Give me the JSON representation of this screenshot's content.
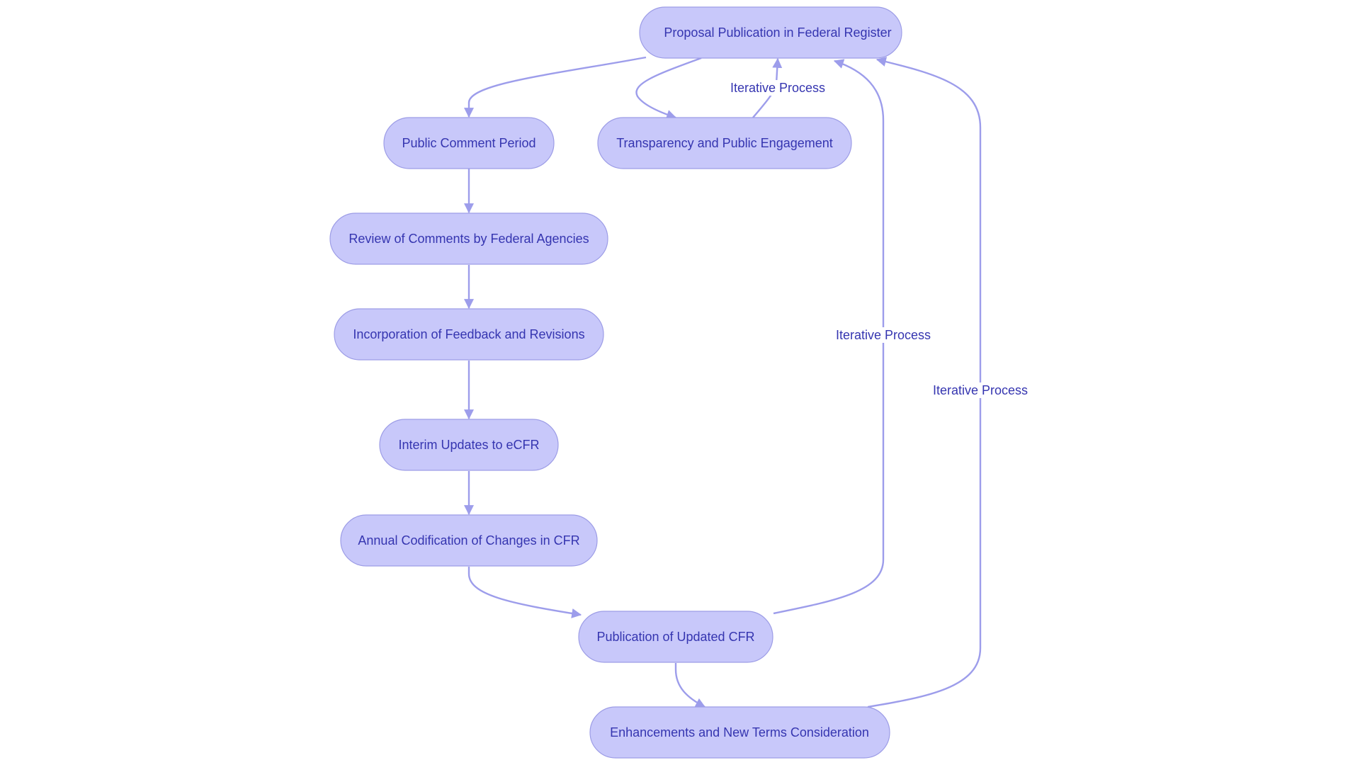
{
  "diagram": {
    "type": "flowchart",
    "colors": {
      "node_fill": "#c8c8fa",
      "node_border": "#9d9de6",
      "text": "#3535b0",
      "edge": "#9d9deb"
    },
    "nodes": [
      {
        "id": "proposal",
        "label": "Proposal Publication in Federal Register"
      },
      {
        "id": "comment",
        "label": "Public Comment Period"
      },
      {
        "id": "transparency",
        "label": "Transparency and Public Engagement"
      },
      {
        "id": "review",
        "label": "Review of Comments by Federal Agencies"
      },
      {
        "id": "incorporation",
        "label": "Incorporation of Feedback and Revisions"
      },
      {
        "id": "interim",
        "label": "Interim Updates to eCFR"
      },
      {
        "id": "annual",
        "label": "Annual Codification of Changes in CFR"
      },
      {
        "id": "publication",
        "label": "Publication of Updated CFR"
      },
      {
        "id": "enhancements",
        "label": "Enhancements and New Terms Consideration"
      }
    ],
    "edges": [
      {
        "from": "proposal",
        "to": "comment",
        "label": ""
      },
      {
        "from": "proposal",
        "to": "transparency",
        "label": ""
      },
      {
        "from": "transparency",
        "to": "proposal",
        "label": "Iterative Process"
      },
      {
        "from": "comment",
        "to": "review",
        "label": ""
      },
      {
        "from": "review",
        "to": "incorporation",
        "label": ""
      },
      {
        "from": "incorporation",
        "to": "interim",
        "label": ""
      },
      {
        "from": "interim",
        "to": "annual",
        "label": ""
      },
      {
        "from": "annual",
        "to": "publication",
        "label": ""
      },
      {
        "from": "publication",
        "to": "proposal",
        "label": "Iterative Process"
      },
      {
        "from": "publication",
        "to": "enhancements",
        "label": ""
      },
      {
        "from": "enhancements",
        "to": "proposal",
        "label": "Iterative Process"
      }
    ]
  }
}
